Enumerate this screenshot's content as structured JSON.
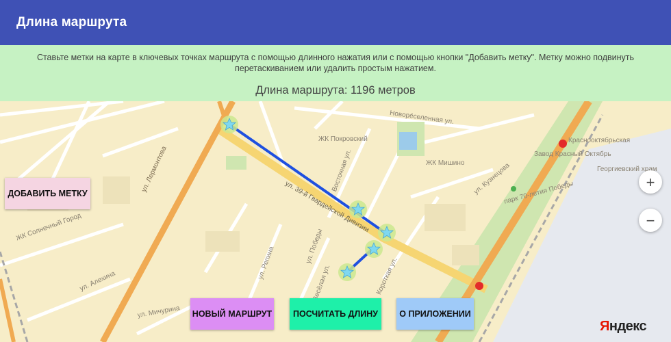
{
  "appbar": {
    "title": "Длина маршрута"
  },
  "info": {
    "hint": "Ставьте метки на карте в ключевых точках маршрута с помощью длинного нажатия или с помощью кнопки \"Добавить метку\". Метку можно подвинуть перетаскиванием или удалить простым нажатием.",
    "route_length": "Длина маршрута: 1196 метров"
  },
  "buttons": {
    "add_marker": "ДОБАВИТЬ МЕТКУ",
    "new_route": "НОВЫЙ МАРШРУТ",
    "calculate": "ПОСЧИТАТЬ ДЛИНУ",
    "about": "О ПРИЛОЖЕНИИ"
  },
  "zoom": {
    "in": "+",
    "out": "−"
  },
  "map": {
    "logo_first": "Я",
    "logo_rest": "ндекс",
    "labels": {
      "lermontov": "ул. Лермонтова",
      "guard": "ул. 39-й Гвардейской Дивизии",
      "pokrovsky": "ЖК Покровский",
      "mishino": "ЖК Мишино",
      "krasny": "Завод Красный Октябрь",
      "georgievsky": "Георгиевский храм",
      "park": "парк 70-летия Победы",
      "kuznetsova": "ул. Кузнецова",
      "pobedy": "ул. Победы",
      "aleksina": "ул. Алехина",
      "michurina": "ул. Мичурина",
      "vesyolaya": "Весёлая ул.",
      "vostochnaya": "Восточная ул.",
      "novoroselennaya": "Новорёселенная ул.",
      "repina": "ул. Репина",
      "krasnooktyabrskaya": "Краснооктябрьская",
      "solnechny": "ЖК Солнечный Город",
      "korotkaya": "Короткая ул."
    }
  },
  "colors": {
    "appbar": "#3f51b5",
    "info": "#c6f2c3",
    "route": "#1e50e0"
  }
}
